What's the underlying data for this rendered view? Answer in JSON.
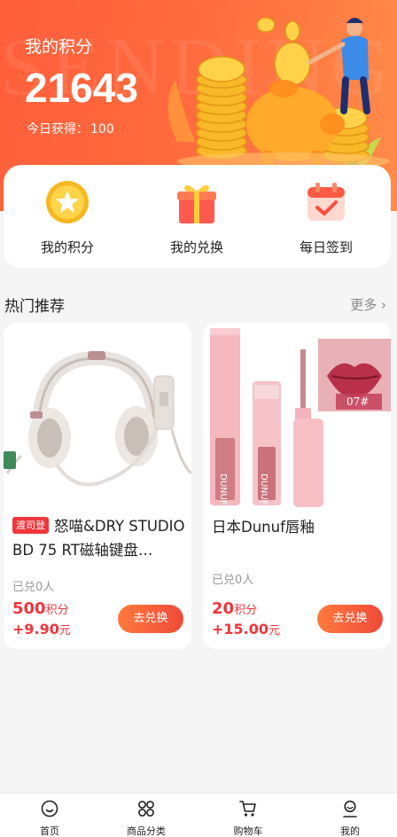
{
  "header": {
    "watermark": "SENDING",
    "title": "我的积分",
    "points": "21643",
    "today_label": "今日获得：",
    "today_value": "100"
  },
  "quick_menu": [
    {
      "label": "我的积分",
      "icon": "star-coin-icon"
    },
    {
      "label": "我的兑换",
      "icon": "gift-box-icon"
    },
    {
      "label": "每日签到",
      "icon": "calendar-check-icon"
    }
  ],
  "section": {
    "title": "热门推荐",
    "more": "更多"
  },
  "products": [
    {
      "tag": "渡司登",
      "name": "怒喵&DRY STUDIO BD 75 RT磁轴键盘…",
      "sold": "已兑0人",
      "points": "500",
      "points_unit": "积分",
      "cash": "+9.90",
      "cash_unit": "元",
      "button": "去兑换"
    },
    {
      "tag": "",
      "name": "日本Dunuf唇釉",
      "sold": "已兑0人",
      "points": "20",
      "points_unit": "积分",
      "cash": "+15.00",
      "cash_unit": "元",
      "button": "去兑换",
      "image_text": {
        "brand": "DUNUF",
        "shade": "07#"
      }
    }
  ],
  "tabbar": [
    {
      "label": "首页",
      "icon": "home-smile-icon"
    },
    {
      "label": "商品分类",
      "icon": "category-grid-icon"
    },
    {
      "label": "购物车",
      "icon": "cart-icon"
    },
    {
      "label": "我的",
      "icon": "user-icon"
    }
  ],
  "colors": {
    "brand": "#ff6a3d",
    "price": "#f0353c",
    "button_start": "#ff7a3d",
    "button_end": "#f04a3a"
  }
}
